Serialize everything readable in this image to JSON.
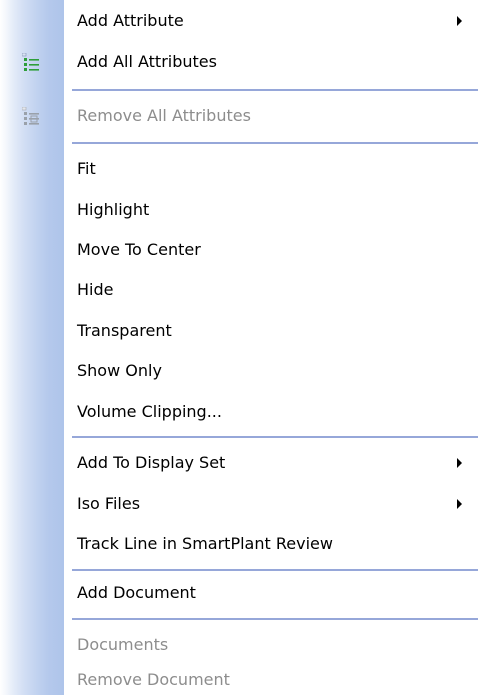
{
  "menu": {
    "items": [
      {
        "label": "Add Attribute",
        "submenu": true,
        "disabled": false
      },
      {
        "label": "Add All Attributes",
        "submenu": false,
        "disabled": false,
        "icon": "add-list-icon"
      },
      {
        "label": "Remove All Attributes",
        "submenu": false,
        "disabled": true,
        "icon": "remove-list-icon"
      },
      {
        "label": "Fit",
        "submenu": false,
        "disabled": false
      },
      {
        "label": "Highlight",
        "submenu": false,
        "disabled": false
      },
      {
        "label": "Move To Center",
        "submenu": false,
        "disabled": false
      },
      {
        "label": "Hide",
        "submenu": false,
        "disabled": false
      },
      {
        "label": "Transparent",
        "submenu": false,
        "disabled": false
      },
      {
        "label": "Show Only",
        "submenu": false,
        "disabled": false
      },
      {
        "label": "Volume Clipping...",
        "submenu": false,
        "disabled": false
      },
      {
        "label": "Add To Display Set",
        "submenu": true,
        "disabled": false
      },
      {
        "label": "Iso Files",
        "submenu": true,
        "disabled": false
      },
      {
        "label": "Track Line in SmartPlant Review",
        "submenu": false,
        "disabled": false
      },
      {
        "label": "Add Document",
        "submenu": false,
        "disabled": false
      },
      {
        "label": "Documents",
        "submenu": false,
        "disabled": true
      },
      {
        "label": "Remove Document",
        "submenu": false,
        "disabled": true
      }
    ]
  },
  "colors": {
    "gutter": "#aec4ea",
    "separator": "#96a7d9",
    "disabled_text": "#8d8d8d",
    "icon_green": "#2e9e3a"
  }
}
